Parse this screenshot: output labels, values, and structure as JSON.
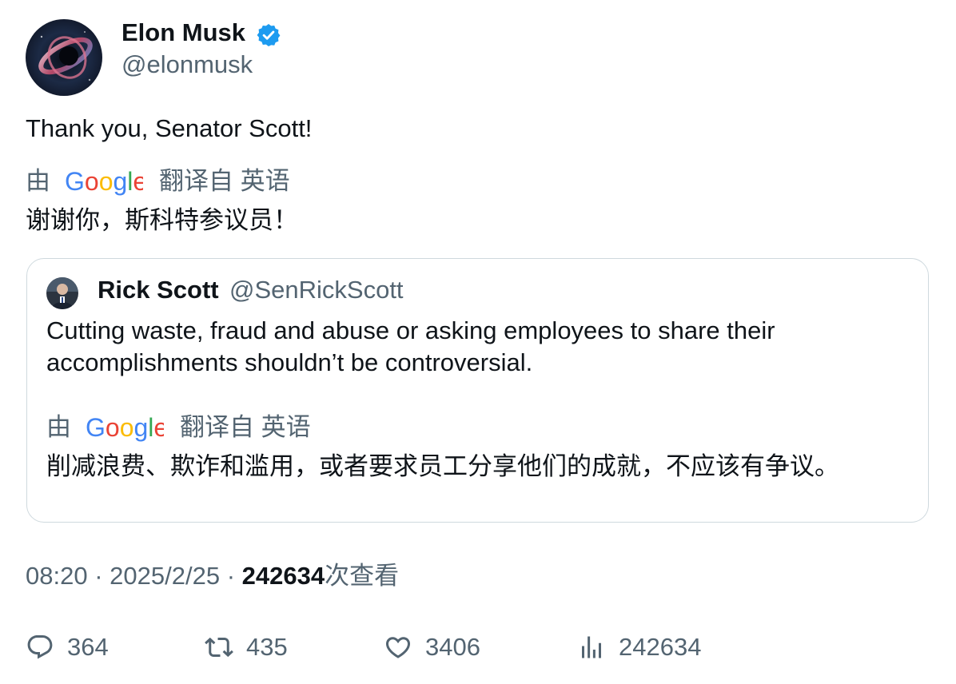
{
  "author": {
    "name": "Elon Musk",
    "handle": "@elonmusk",
    "verified_color": "#1d9bf0"
  },
  "tweet": {
    "text": "Thank you, Senator Scott!",
    "translation": {
      "by_label": "由",
      "logo_name": "google-logo",
      "from_label": "翻译自 英语",
      "text": "谢谢你，斯科特参议员！"
    }
  },
  "quote": {
    "name": "Rick Scott",
    "handle": "@SenRickScott",
    "text": "Cutting waste, fraud and abuse or asking employees to share their accomplishments shouldn’t be controversial.",
    "translation": {
      "by_label": "由",
      "logo_name": "google-logo",
      "from_label": "翻译自 英语",
      "text": "削减浪费、欺诈和滥用，或者要求员工分享他们的成就，不应该有争议。"
    }
  },
  "meta": {
    "time": "08:20",
    "separator": "·",
    "date": "2025/2/25",
    "views_count": "242634",
    "views_label": "次查看"
  },
  "actions": {
    "replies": "364",
    "reposts": "435",
    "likes": "3406",
    "views": "242634"
  },
  "colors": {
    "text_primary": "#0f1419",
    "text_secondary": "#536471",
    "border": "#cfd9de",
    "google_blue": "#4285F4",
    "google_red": "#EA4335",
    "google_yellow": "#FBBC05",
    "google_green": "#34A853"
  }
}
